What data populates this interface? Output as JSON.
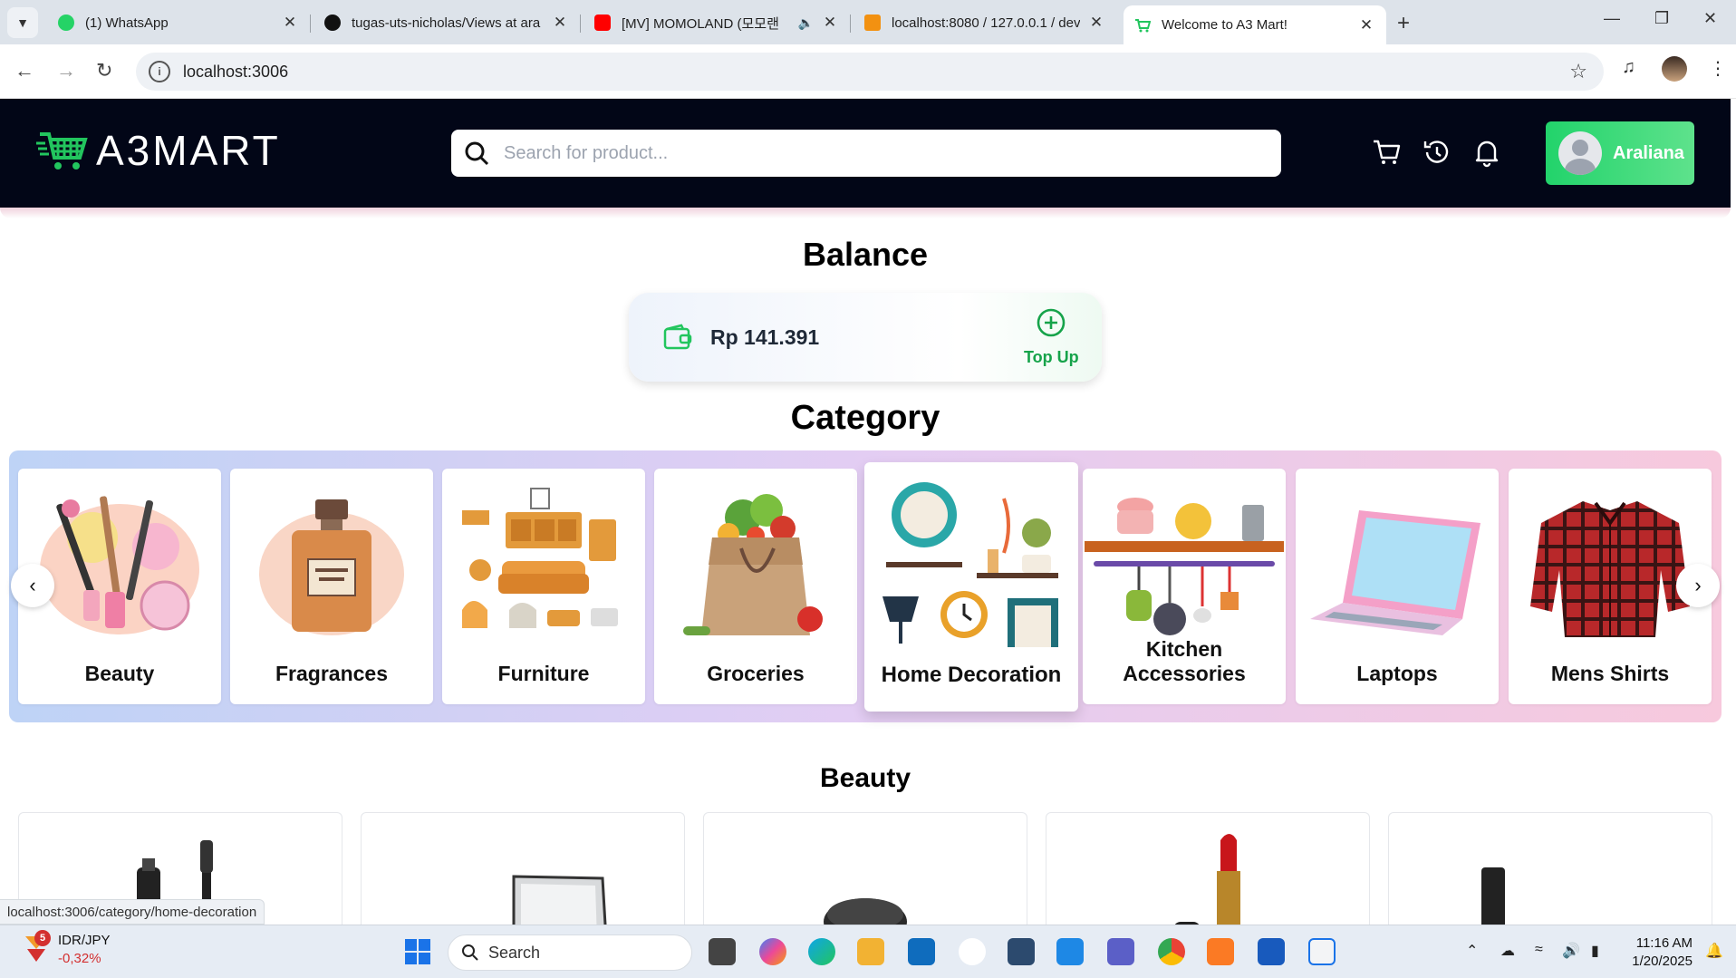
{
  "browser": {
    "tabs": [
      {
        "title": "(1) WhatsApp",
        "color": "#25D366"
      },
      {
        "title": "tugas-uts-nicholas/Views at ara",
        "color": "#111111"
      },
      {
        "title": "[MV] MOMOLAND (모모랜",
        "color": "#FF0000"
      },
      {
        "title": "localhost:8080 / 127.0.0.1 / dev",
        "color": "#F29111"
      },
      {
        "title": "Welcome to A3 Mart!",
        "color": "#22c55e"
      }
    ],
    "url": "localhost:3006",
    "status_url": "localhost:3006/category/home-decoration"
  },
  "header": {
    "logo_text": "A3MART",
    "search_placeholder": "Search for product...",
    "user_name": "Araliana",
    "accent": "#22c55e"
  },
  "balance": {
    "heading": "Balance",
    "amount": "Rp 141.391",
    "topup_label": "Top Up"
  },
  "category": {
    "heading": "Category",
    "items": [
      {
        "label": "Beauty"
      },
      {
        "label": "Fragrances"
      },
      {
        "label": "Furniture"
      },
      {
        "label": "Groceries"
      },
      {
        "label": "Home Decoration"
      },
      {
        "label": "Kitchen Accessories"
      },
      {
        "label": "Laptops"
      },
      {
        "label": "Mens Shirts"
      }
    ]
  },
  "products_section": {
    "heading": "Beauty"
  },
  "taskbar": {
    "ticker_pair": "IDR/JPY",
    "ticker_change": "-0,32%",
    "ticker_badge": "5",
    "search_label": "Search",
    "time": "11:16 AM",
    "date": "1/20/2025"
  }
}
